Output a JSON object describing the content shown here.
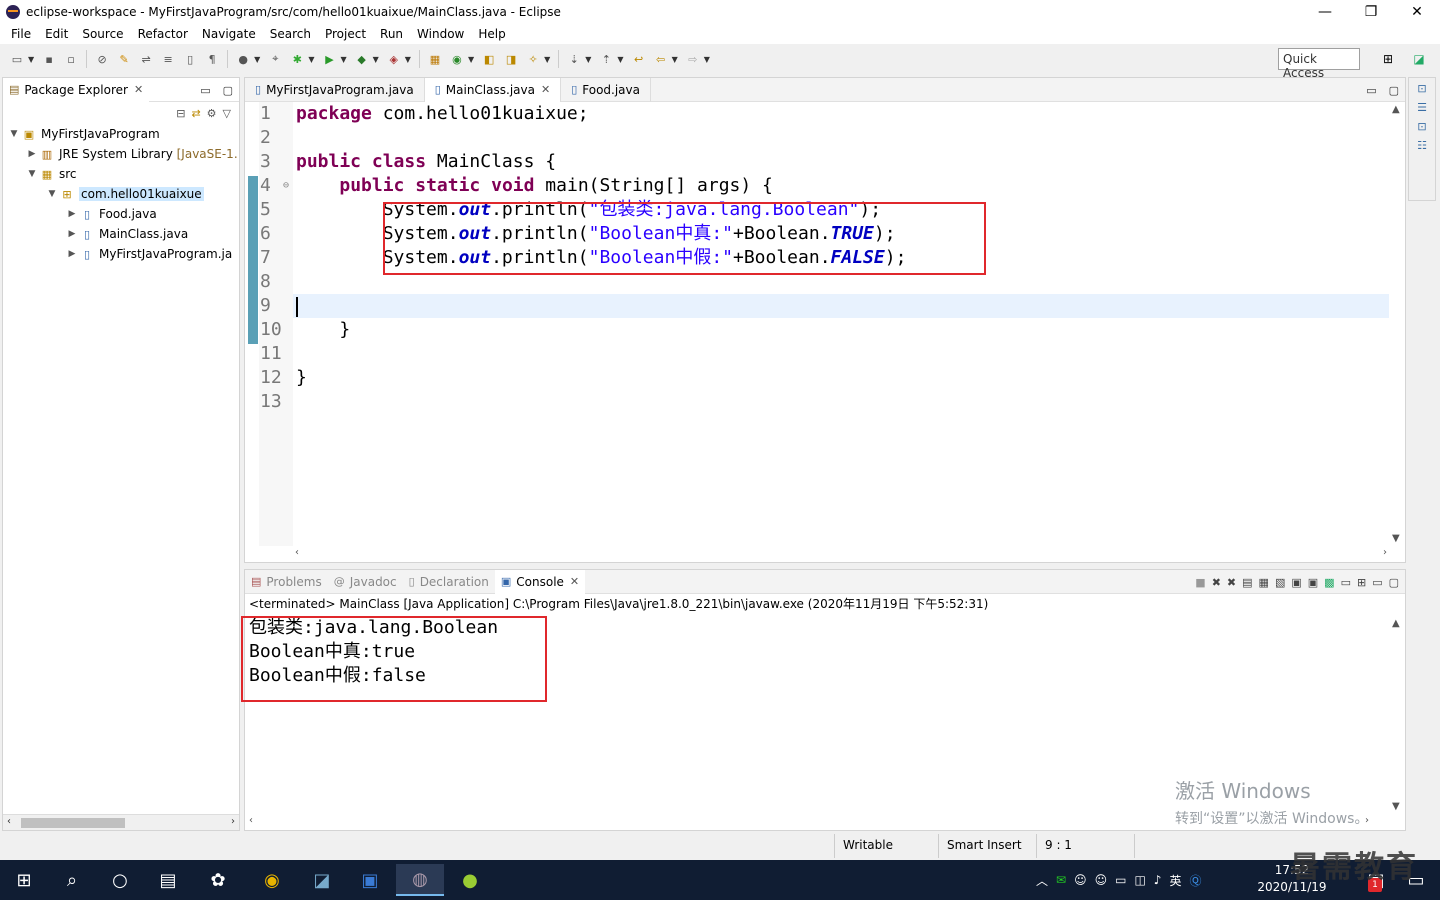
{
  "window": {
    "title": "eclipse-workspace - MyFirstJavaProgram/src/com/hello01kuaixue/MainClass.java - Eclipse",
    "controls": [
      "—",
      "❐",
      "✕"
    ]
  },
  "menu": [
    "File",
    "Edit",
    "Source",
    "Refactor",
    "Navigate",
    "Search",
    "Project",
    "Run",
    "Window",
    "Help"
  ],
  "toolbar": {
    "quick_access": "Quick Access"
  },
  "package_explorer": {
    "title": "Package Explorer",
    "tree": [
      {
        "label": "MyFirstJavaProgram",
        "suffix": ""
      },
      {
        "label": "JRE System Library",
        "suffix": "[JavaSE-1."
      },
      {
        "label": "src",
        "suffix": ""
      },
      {
        "label": "com.hello01kuaixue",
        "suffix": ""
      },
      {
        "label": "Food.java",
        "suffix": ""
      },
      {
        "label": "MainClass.java",
        "suffix": ""
      },
      {
        "label": "MyFirstJavaProgram.ja",
        "suffix": ""
      }
    ]
  },
  "editor": {
    "tabs": [
      "MyFirstJavaProgram.java",
      "MainClass.java",
      "Food.java"
    ],
    "line_numbers": [
      "1",
      "2",
      "3",
      "4",
      "5",
      "6",
      "7",
      "8",
      "9",
      "10",
      "11",
      "12",
      "13"
    ],
    "fold_marker": "⊖",
    "code": {
      "l1_kw": "package",
      "l1_rest": " com.hello01kuaixue;",
      "l3_kw1": "public",
      "l3_kw2": "class",
      "l3_rest": " MainClass {",
      "l4_indent": "    ",
      "l4_kw1": "public",
      "l4_kw2": "static",
      "l4_kw3": "void",
      "l4_rest": " main(String[] args) {",
      "sys": "        System.",
      "out": "out",
      "println": ".println(",
      "l5_str": "\"包装类:java.lang.Boolean\"",
      "l5_end": ");",
      "l6_str": "\"Boolean中真:\"",
      "l6_mid": "+Boolean.",
      "l6_fld": "TRUE",
      "l6_end": ");",
      "l7_str": "\"Boolean中假:\"",
      "l7_mid": "+Boolean.",
      "l7_fld": "FALSE",
      "l7_end": ");",
      "l10": "    }",
      "l12": "}"
    }
  },
  "console": {
    "tabs": [
      "Problems",
      "Javadoc",
      "Declaration",
      "Console"
    ],
    "status": "<terminated> MainClass [Java Application] C:\\Program Files\\Java\\jre1.8.0_221\\bin\\javaw.exe (2020年11月19日 下午5:52:31)",
    "output": [
      "包装类:java.lang.Boolean",
      "Boolean中真:true",
      "Boolean中假:false"
    ],
    "watermark_line1": "激活 Windows",
    "watermark_line2": "转到“设置”以激活 Windows。"
  },
  "statusbar": {
    "writable": "Writable",
    "insert_mode": "Smart Insert",
    "position": "9 : 1"
  },
  "taskbar": {
    "tray_text": "英",
    "time": "17:52",
    "date": "2020/11/19",
    "badge": "1"
  },
  "overlay_brand": "暑需教育"
}
